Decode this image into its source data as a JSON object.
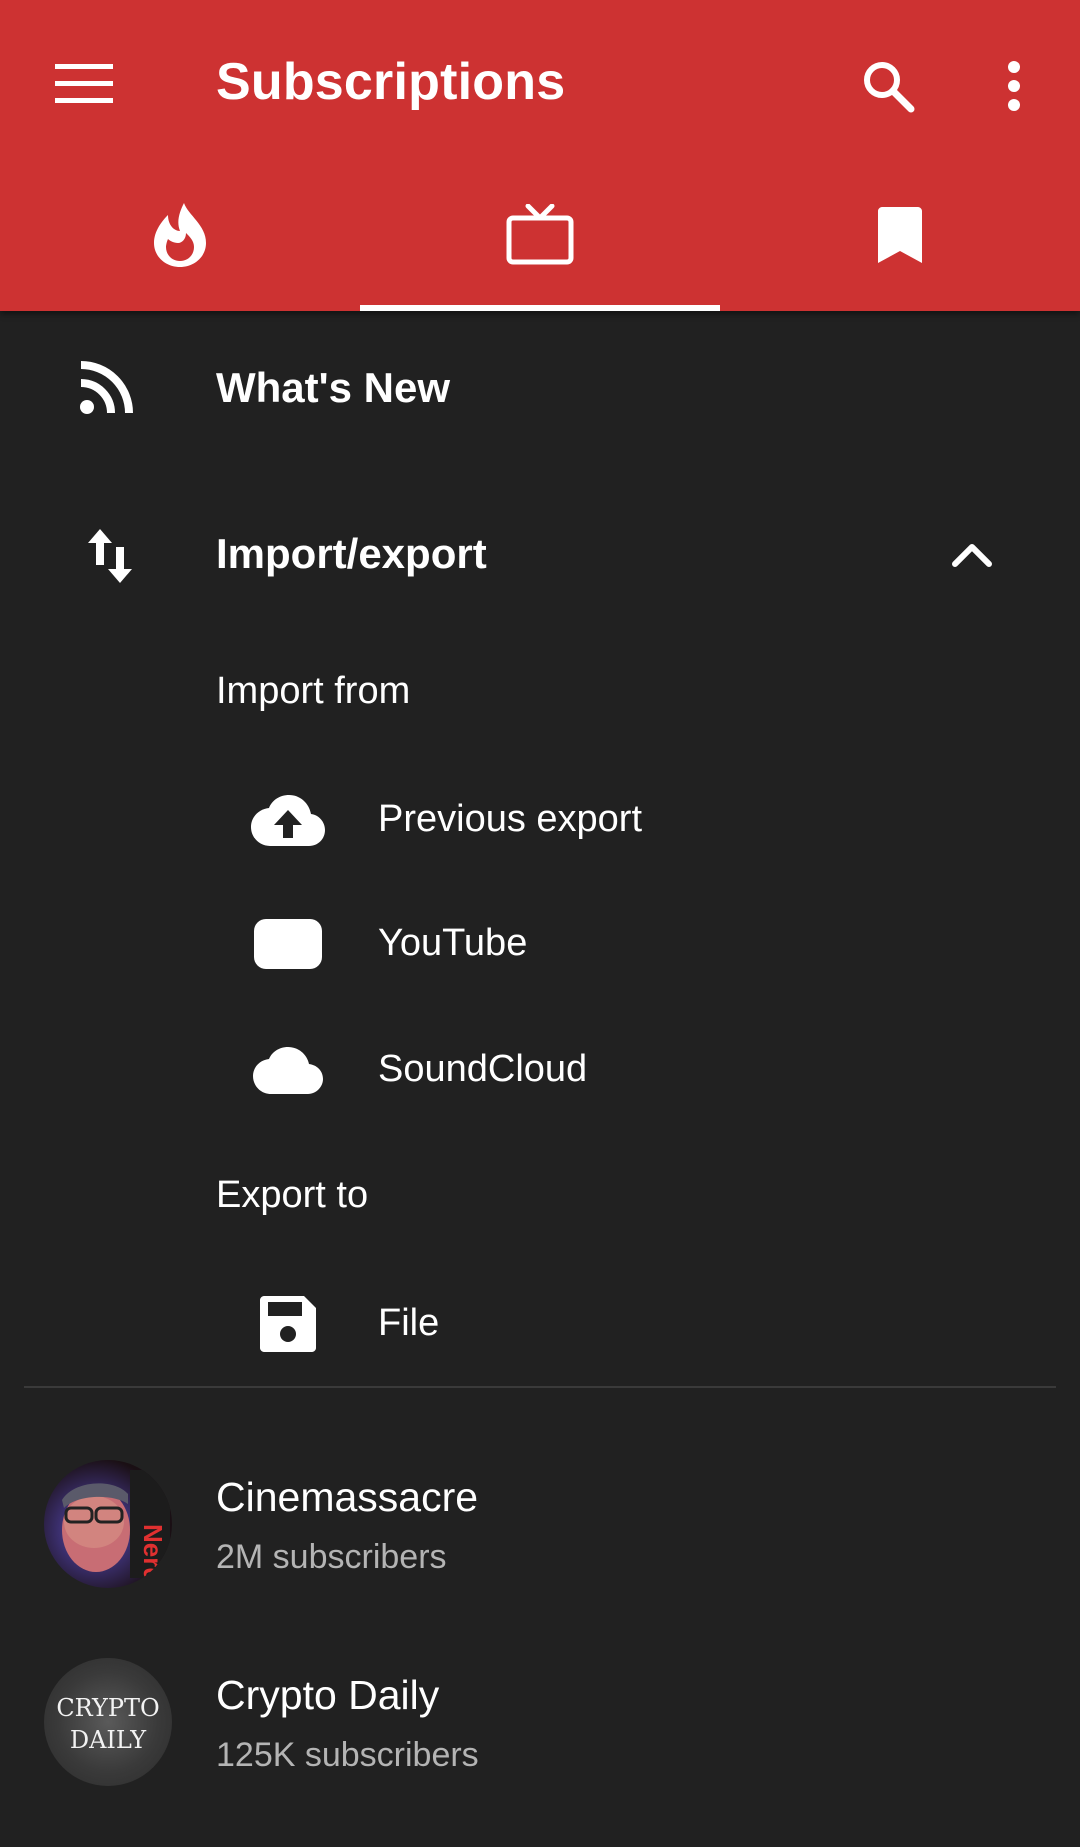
{
  "header": {
    "title": "Subscriptions",
    "icons": {
      "menu": "hamburger-menu-icon",
      "search": "search-icon",
      "more": "more-vertical-icon"
    }
  },
  "tabs": [
    {
      "icon": "trending-fire-icon",
      "active": false
    },
    {
      "icon": "tv-icon",
      "active": true
    },
    {
      "icon": "bookmark-icon",
      "active": false
    }
  ],
  "feed": {
    "whats_new_label": "What's New"
  },
  "import_export": {
    "label": "Import/export",
    "expanded": true,
    "import_from_label": "Import from",
    "import_items": [
      {
        "label": "Previous export",
        "icon": "cloud-upload-icon"
      },
      {
        "label": "YouTube",
        "icon": "youtube-icon"
      },
      {
        "label": "SoundCloud",
        "icon": "soundcloud-cloud-icon"
      }
    ],
    "export_to_label": "Export to",
    "export_items": [
      {
        "label": "File",
        "icon": "save-disk-icon"
      }
    ]
  },
  "subscriptions": [
    {
      "name": "Cinemassacre",
      "subscribers": "2M subscribers",
      "avatar_text": "Nerd"
    },
    {
      "name": "Crypto Daily",
      "subscribers": "125K subscribers",
      "avatar_text_1": "CRYPTO",
      "avatar_text_2": "DAILY"
    }
  ],
  "colors": {
    "appbar": "#cd3232",
    "background": "#212121",
    "secondary_text": "#b4b4b4"
  }
}
